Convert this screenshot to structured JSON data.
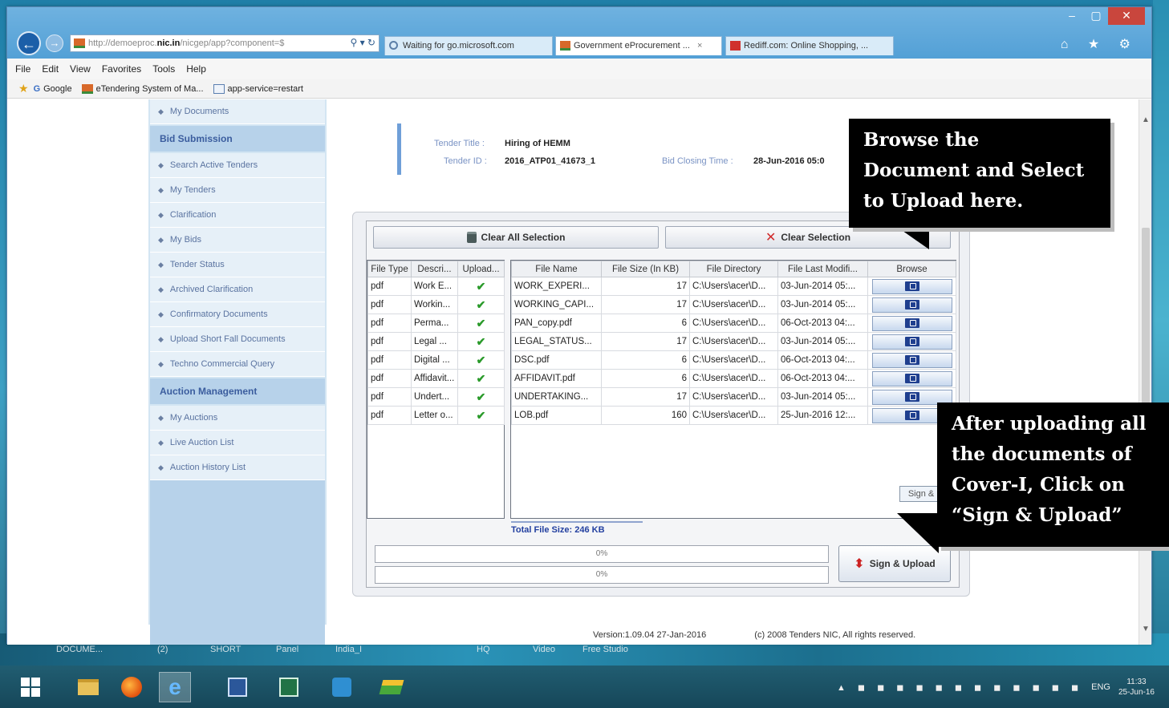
{
  "browser": {
    "address": {
      "prefix": "http://demoeproc.",
      "domain": "nic.in",
      "suffix": "/nicgep/app?component=$"
    },
    "address_actions": "⚲ ▾ ↻",
    "tabs": [
      {
        "label": "Waiting for go.microsoft.com",
        "close": ""
      },
      {
        "label": "Government eProcurement ...",
        "close": "×"
      },
      {
        "label": "Rediff.com: Online Shopping, ...",
        "close": ""
      }
    ],
    "right_icons": "⌂ ★ ⚙",
    "menu": [
      "File",
      "Edit",
      "View",
      "Favorites",
      "Tools",
      "Help"
    ],
    "favorites": [
      "Google",
      "eTendering System of Ma...",
      "app-service=restart"
    ]
  },
  "sidebar": {
    "items_top": [
      "My Documents"
    ],
    "bid_submission_header": "Bid Submission",
    "bid_items": [
      "Search Active Tenders",
      "My Tenders",
      "Clarification",
      "My Bids",
      "Tender Status",
      "Archived Clarification",
      "Confirmatory Documents",
      "Upload Short Fall Documents",
      "Techno Commercial Query"
    ],
    "auction_header": "Auction Management",
    "auction_items": [
      "My Auctions",
      "Live Auction List",
      "Auction History List"
    ]
  },
  "tender": {
    "title_label": "Tender Title :",
    "title_value": "Hiring of HEMM",
    "id_label": "Tender ID :",
    "id_value": "2016_ATP01_41673_1",
    "closing_label": "Bid Closing Time :",
    "closing_value": "28-Jun-2016 05:0"
  },
  "applet": {
    "clear_all": "Clear All Selection",
    "clear_selection": "Clear Selection",
    "left_headers": [
      "File Type",
      "Descri...",
      "Upload..."
    ],
    "right_headers": [
      "File Name",
      "File Size (In KB)",
      "File Directory",
      "File Last Modifi...",
      "Browse"
    ],
    "rows": [
      {
        "type": "pdf",
        "desc": "Work E...",
        "upload": "✔",
        "name": "WORK_EXPERI...",
        "size": "17",
        "dir": "C:\\Users\\acer\\D...",
        "modified": "03-Jun-2014 05:..."
      },
      {
        "type": "pdf",
        "desc": "Workin...",
        "upload": "✔",
        "name": "WORKING_CAPI...",
        "size": "17",
        "dir": "C:\\Users\\acer\\D...",
        "modified": "03-Jun-2014 05:..."
      },
      {
        "type": "pdf",
        "desc": "Perma...",
        "upload": "✔",
        "name": "PAN_copy.pdf",
        "size": "6",
        "dir": "C:\\Users\\acer\\D...",
        "modified": "06-Oct-2013 04:..."
      },
      {
        "type": "pdf",
        "desc": "Legal ...",
        "upload": "✔",
        "name": "LEGAL_STATUS...",
        "size": "17",
        "dir": "C:\\Users\\acer\\D...",
        "modified": "03-Jun-2014 05:..."
      },
      {
        "type": "pdf",
        "desc": "Digital ...",
        "upload": "✔",
        "name": "DSC.pdf",
        "size": "6",
        "dir": "C:\\Users\\acer\\D...",
        "modified": "06-Oct-2013 04:..."
      },
      {
        "type": "pdf",
        "desc": "Affidavit...",
        "upload": "✔",
        "name": "AFFIDAVIT.pdf",
        "size": "6",
        "dir": "C:\\Users\\acer\\D...",
        "modified": "06-Oct-2013 04:..."
      },
      {
        "type": "pdf",
        "desc": "Undert...",
        "upload": "✔",
        "name": "UNDERTAKING...",
        "size": "17",
        "dir": "C:\\Users\\acer\\D...",
        "modified": "03-Jun-2014 05:..."
      },
      {
        "type": "pdf",
        "desc": "Letter o...",
        "upload": "✔",
        "name": "LOB.pdf",
        "size": "160",
        "dir": "C:\\Users\\acer\\D...",
        "modified": "25-Jun-2016 12:..."
      }
    ],
    "total_size": "Total File Size: 246 KB",
    "progress1": "0%",
    "progress2": "0%",
    "sign_upload": "Sign & Upload",
    "tooltip": "Sign & Upload"
  },
  "footer": {
    "version": "Version:1.09.04 27-Jan-2016",
    "copyright": "(c) 2008 Tenders NIC, All rights reserved."
  },
  "callouts": {
    "browse": [
      "Browse the",
      "Document and Select",
      "to Upload here."
    ],
    "sign": [
      "After uploading all",
      "the documents of",
      "Cover-I, Click on",
      "“Sign & Upload”"
    ]
  },
  "desktop": {
    "strip_labels": [
      "DOCUME...",
      "(2)",
      "SHORT",
      "Panel",
      "India_I",
      "HQ",
      "Video",
      "Free Studio"
    ]
  },
  "taskbar": {
    "time": "11:33",
    "date": "25-Jun-16",
    "lang": "ENG"
  },
  "colors": {
    "accent": "#53a0d6",
    "sidebar_header": "#3b5d9e",
    "callout_bg": "#000000",
    "check": "#2a9a2a"
  }
}
